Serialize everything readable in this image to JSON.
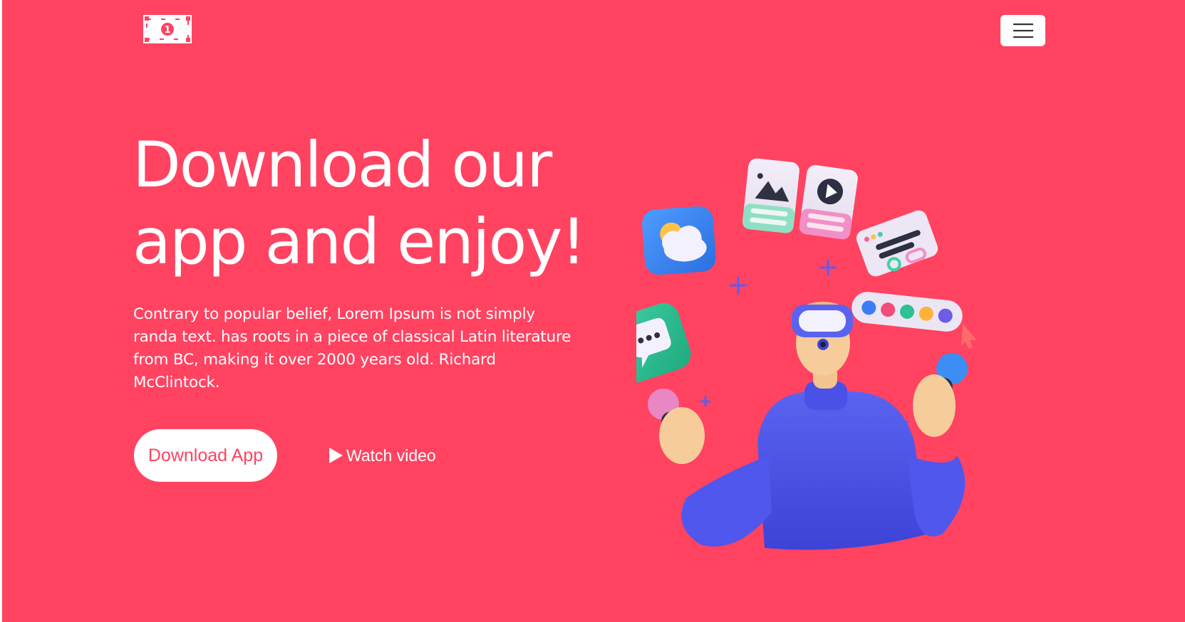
{
  "header": {
    "logo_icon": "dollar-bill-icon",
    "menu_icon": "hamburger-menu-icon"
  },
  "hero": {
    "headline_line1": "Download our",
    "headline_line2": "app and enjoy!",
    "description": "Contrary to popular belief, Lorem Ipsum is not simply randa text. has roots in a piece of classical Latin literature from BC, making it over 2000 years old. Richard McClintock.",
    "download_button_label": "Download App",
    "watch_video_label": "Watch video",
    "watch_video_icon": "play-icon"
  },
  "illustration": {
    "subject": "3d-person-with-vr-headset-and-app-icons"
  },
  "colors": {
    "background": "#ff4361",
    "button_text": "#ff4361",
    "text": "#ffffff"
  }
}
